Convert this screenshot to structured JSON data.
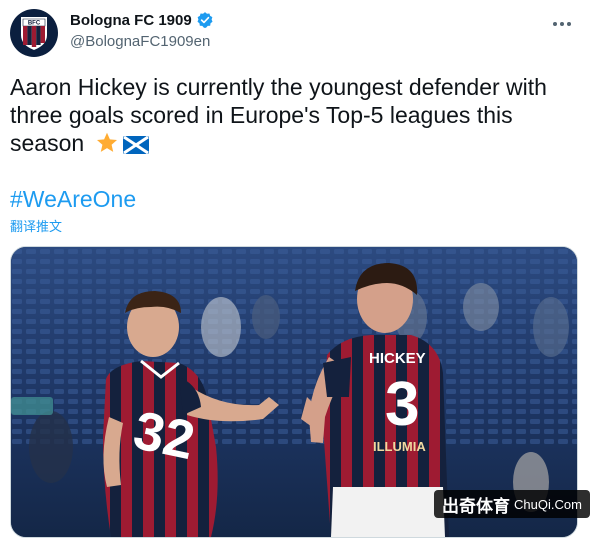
{
  "account": {
    "display_name": "Bologna FC 1909",
    "handle": "@BolognaFC1909en",
    "avatar_icon": "bologna-crest-icon",
    "avatar_text": "BFC"
  },
  "tweet": {
    "text": "Aaron Hickey is currently the youngest defender with three goals scored in Europe's Top-5 leagues this season",
    "emojis": [
      "star-emoji",
      "scotland-flag-emoji"
    ],
    "hashtag": "#WeAreOne",
    "translate_label": "翻译推文"
  },
  "media": {
    "player_left_number": "32",
    "player_right_name": "HICKEY",
    "player_right_number": "3",
    "sponsor_text": "ILLUMIA"
  },
  "watermark": {
    "cn": "出奇体育",
    "en": "ChuQi.Com"
  },
  "colors": {
    "link": "#1d9bf0",
    "text": "#0f1419",
    "secondary": "#536471",
    "jersey_red": "#9e1b32",
    "jersey_navy": "#14213d"
  }
}
